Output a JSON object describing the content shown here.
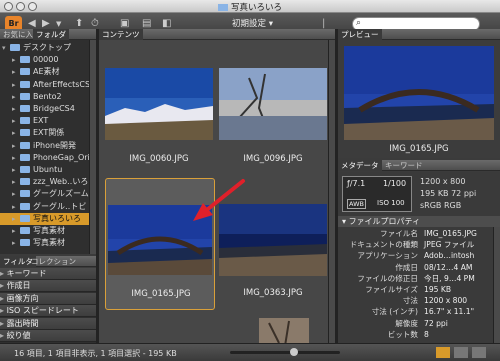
{
  "window": {
    "title": "写真いろいろ"
  },
  "toolbar": {
    "app_logo": "Br",
    "preset_label": "初期設定",
    "search_placeholder": ""
  },
  "left_tabs": [
    "お気に入り",
    "フォルダ"
  ],
  "folders": [
    {
      "label": "デスクトップ",
      "level": 0
    },
    {
      "label": "00000",
      "level": 1
    },
    {
      "label": "AE素材",
      "level": 1
    },
    {
      "label": "AfterEffectsCS",
      "level": 1
    },
    {
      "label": "Bento2",
      "level": 1
    },
    {
      "label": "BridgeCS4",
      "level": 1
    },
    {
      "label": "EXT",
      "level": 1
    },
    {
      "label": "EXT関係",
      "level": 1
    },
    {
      "label": "iPhone開発",
      "level": 1
    },
    {
      "label": "PhoneGap_Ori",
      "level": 1
    },
    {
      "label": "Ubuntu",
      "level": 1
    },
    {
      "label": "zzz_Web‥いろ",
      "level": 1
    },
    {
      "label": "グーグルズーム",
      "level": 1
    },
    {
      "label": "グーグル‥トビ",
      "level": 1
    },
    {
      "label": "写真いろいろ",
      "level": 1,
      "selected": true
    },
    {
      "label": "写真素材",
      "level": 1
    },
    {
      "label": "写真素材",
      "level": 1
    }
  ],
  "filter_tabs": [
    "フィルタ",
    "コレクション"
  ],
  "filters": [
    "キーワード",
    "作成日",
    "画像方向",
    "ISO スピードレート",
    "露出時間",
    "絞り値"
  ],
  "content_tab": "コンテンツ",
  "thumbnails": [
    {
      "name": "IMG_0060.JPG",
      "selected": false
    },
    {
      "name": "IMG_0096.JPG",
      "selected": false
    },
    {
      "name": "IMG_0165.JPG",
      "selected": true
    },
    {
      "name": "IMG_0363.JPG",
      "selected": false
    }
  ],
  "preview": {
    "tab": "プレビュー",
    "caption": "IMG_0165.JPG"
  },
  "metadata_tabs": [
    "メタデータ",
    "キーワード"
  ],
  "camera_box": {
    "aperture": "ƒ/7.1",
    "shutter": "1/100",
    "iso": "ISO 100",
    "wb": "AWB",
    "dimensions": "1200 x 800",
    "size_ppi": "195 KB  72 ppi",
    "color": "sRGB    RGB"
  },
  "file_props_title": "ファイルプロパティ",
  "file_props": [
    {
      "k": "ファイル名",
      "v": "IMG_0165.JPG"
    },
    {
      "k": "ドキュメントの種類",
      "v": "JPEG ファイル"
    },
    {
      "k": "アプリケーション",
      "v": "Adob…intosh"
    },
    {
      "k": "作成日",
      "v": "08/12…4 AM"
    },
    {
      "k": "ファイルの修正日",
      "v": "今日, 9…4 PM"
    },
    {
      "k": "ファイルサイズ",
      "v": "195 KB"
    },
    {
      "k": "寸法",
      "v": "1200 x 800"
    },
    {
      "k": "寸法 (インチ)",
      "v": "16.7\" x 11.1\""
    },
    {
      "k": "解像度",
      "v": "72 ppi"
    },
    {
      "k": "ビット数",
      "v": "8"
    }
  ],
  "status": "16 項目, 1 項目非表示, 1 項目選択 - 195 KB",
  "colors": {
    "accent": "#d89a2a",
    "folder": "#8ab4e6",
    "arrow": "#e0202a"
  }
}
